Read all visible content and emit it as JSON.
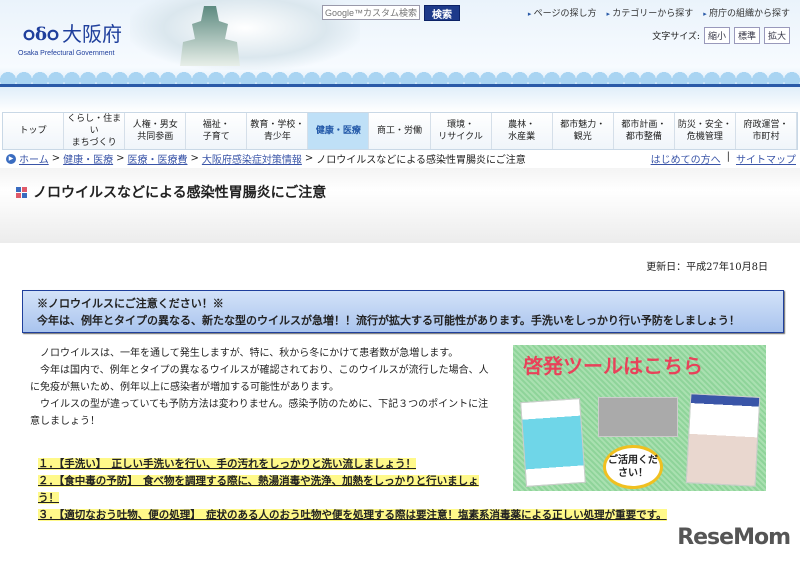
{
  "header": {
    "logo_text": "大阪府",
    "logo_en": "Osaka Prefectural Government",
    "search_placeholder": "Google™カスタム検索",
    "search_button": "検索",
    "top_links": [
      "ページの探し方",
      "カテゴリーから探す",
      "府庁の組織から探す"
    ],
    "font_size_label": "文字サイズ:",
    "font_size_buttons": [
      "縮小",
      "標準",
      "拡大"
    ]
  },
  "nav": {
    "items": [
      "トップ",
      "くらし・住まい\nまちづくり",
      "人権・男女\n共同参画",
      "福祉・\n子育て",
      "教育・学校・\n青少年",
      "健康・医療",
      "商工・労働",
      "環境・\nリサイクル",
      "農林・\n水産業",
      "都市魅力・\n観光",
      "都市計画・\n都市整備",
      "防災・安全・\n危機管理",
      "府政運営・\n市町村"
    ],
    "active": "健康・医療"
  },
  "breadcrumb": {
    "items": [
      "ホーム",
      "健康・医療",
      "医療・医療費",
      "大阪府感染症対策情報"
    ],
    "current": "ノロウイルスなどによる感染性胃腸炎にご注意",
    "links": [
      "はじめての方へ",
      "サイトマップ"
    ]
  },
  "page": {
    "title": "ノロウイルスなどによる感染性胃腸炎にご注意",
    "updated": "更新日：平成27年10月8日",
    "notice": {
      "heading": "※ノロウイルスにご注意ください！※",
      "text": "今年は、例年とタイプの異なる、新たな型のウイルスが急増！！流行が拡大する可能性があります。手洗いをしっかり行い予防をしましょう！"
    },
    "paragraphs": [
      "ノロウイルスは、一年を通して発生しますが、特に、秋から冬にかけて患者数が急増します。",
      "今年は国内で、例年とタイプの異なるウイルスが確認されており、このウイルスが流行した場合、人に免疫が無いため、例年以上に感染者が増加する可能性があります。",
      "ウイルスの型が違っていても予防方法は変わりません。感染予防のために、下記３つのポイントに注意しましょう！"
    ],
    "points": [
      "１．【手洗い】　正しい手洗いを行い、手の汚れをしっかりと洗い流しましょう！",
      "２．【食中毒の予防】　食べ物を調理する際に、熱湯消毒や洗浄、加熱をしっかりと行いましょう！",
      "３．【適切なおう吐物、便の処理】　症状のある人のおう吐物や便を処理する際は要注意！塩素系消毒薬による正しい処理が重要です。"
    ],
    "tool_banner": {
      "title": "啓発ツールはこちら",
      "badge": "ご活用ください！"
    }
  },
  "watermark": "ReseMom",
  "colors": {
    "accent": "#1f3f9c",
    "highlight": "#fff98a",
    "nav_active": "#bfe0f7"
  }
}
